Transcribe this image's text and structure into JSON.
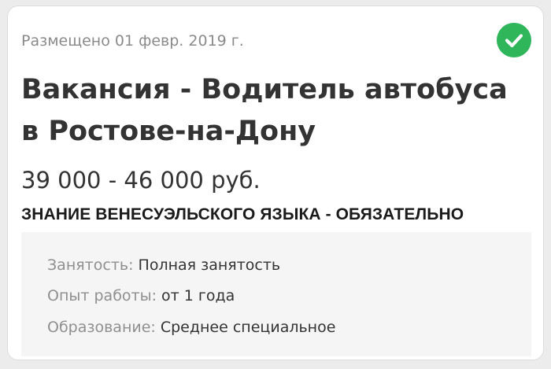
{
  "posted": "Размещено 01 февр. 2019 г.",
  "title": "Вакансия - Водитель автобуса в Ростове-на-Дону",
  "salary": "39 000 - 46 000 руб.",
  "requirement": "ЗНАНИЕ ВЕНЕСУЭЛЬСКОГО ЯЗЫКА - ОБЯЗАТЕЛЬНО",
  "details": [
    {
      "label": "Занятость:",
      "value": "Полная занятость"
    },
    {
      "label": "Опыт работы:",
      "value": "от 1 года"
    },
    {
      "label": "Образование:",
      "value": "Среднее специальное"
    }
  ],
  "icons": {
    "verified": "check-circle-icon"
  },
  "colors": {
    "verified_green": "#2fb55a",
    "details_background": "#f5f5f5",
    "muted_text": "#8a8a8a",
    "main_text": "#333333"
  }
}
